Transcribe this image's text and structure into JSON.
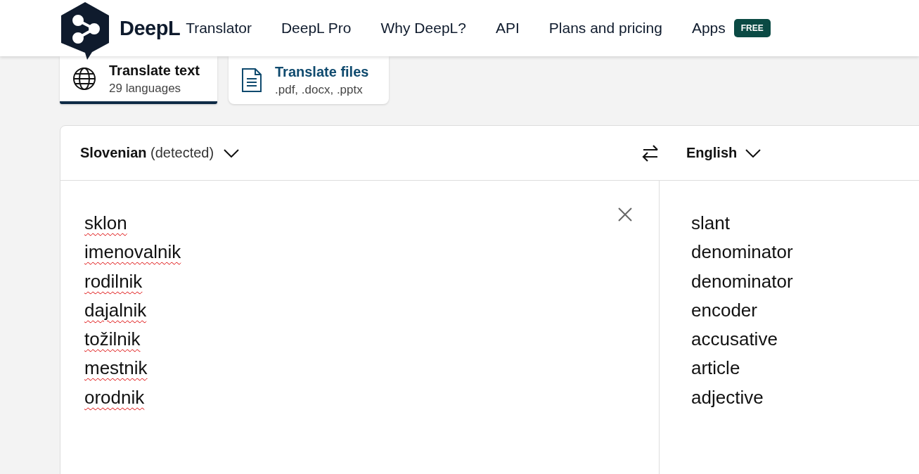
{
  "header": {
    "brand": "DeepL",
    "product": "Translator",
    "nav": [
      "DeepL Pro",
      "Why DeepL?",
      "API",
      "Plans and pricing"
    ],
    "apps": {
      "label": "Apps",
      "badge": "FREE"
    }
  },
  "modes": [
    {
      "kind": "text",
      "title": "Translate text",
      "subtitle": "29 languages",
      "selected": true
    },
    {
      "kind": "files",
      "title": "Translate files",
      "subtitle": ".pdf, .docx, .pptx",
      "selected": false
    }
  ],
  "translator": {
    "source_language": "Slovenian",
    "source_note": "(detected)",
    "target_language": "English",
    "source_lines": [
      {
        "text": "sklon",
        "misspelled": true
      },
      {
        "text": "imenovalnik",
        "misspelled": true
      },
      {
        "text": "rodilnik",
        "misspelled": true
      },
      {
        "text": "dajalnik",
        "misspelled": true
      },
      {
        "text": "tožilnik",
        "misspelled": true
      },
      {
        "text": "mestnik",
        "misspelled": true
      },
      {
        "text": "orodnik",
        "misspelled": true
      }
    ],
    "target_lines": [
      "slant",
      "denominator",
      "denominator",
      "encoder",
      "accusative",
      "article",
      "adjective"
    ]
  }
}
